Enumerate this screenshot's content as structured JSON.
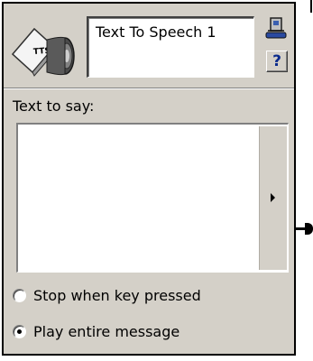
{
  "node": {
    "title": "Text To Speech 1",
    "icon": "tts-icon",
    "icon_text": "TTS",
    "hangup_icon": "hangup-phone-icon",
    "help_label": "?"
  },
  "text": {
    "label": "Text to say:",
    "value": "",
    "expand_icon": "triangle-right-icon"
  },
  "options": {
    "stop_label": "Stop when key pressed",
    "stop_selected": false,
    "play_label": "Play entire message",
    "play_selected": true
  },
  "colors": {
    "panel_bg": "#d4d0c8",
    "field_bg": "#ffffff",
    "help_text": "#0a2a8c",
    "border": "#000000"
  }
}
